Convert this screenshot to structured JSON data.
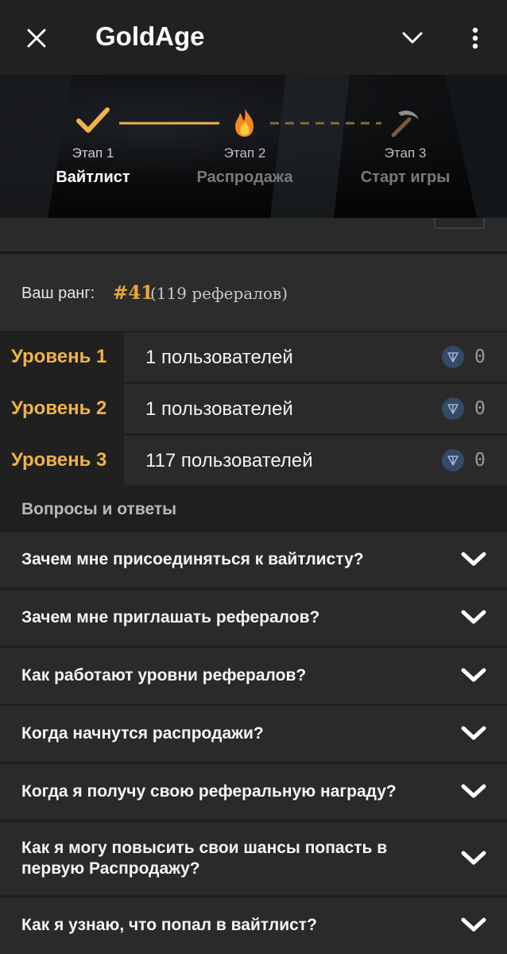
{
  "header": {
    "title": "GoldAge",
    "close_icon": "close-icon",
    "collapse_icon": "chevron-down-icon",
    "menu_icon": "more-vertical-icon"
  },
  "stages": [
    {
      "number": "Этап 1",
      "label": "Вайтлист",
      "icon": "check-icon",
      "state": "done"
    },
    {
      "number": "Этап 2",
      "label": "Распродажа",
      "icon": "fire-icon",
      "state": "current"
    },
    {
      "number": "Этап 3",
      "label": "Старт игры",
      "icon": "pickaxe-icon",
      "state": "upcoming"
    }
  ],
  "rank": {
    "label": "Ваш ранг:",
    "value": "#41",
    "referrals": "(119 рефералов)"
  },
  "levels": [
    {
      "label": "Уровень 1",
      "users": "1 пользователей",
      "reward": "0"
    },
    {
      "label": "Уровень 2",
      "users": "1 пользователей",
      "reward": "0"
    },
    {
      "label": "Уровень 3",
      "users": "117 пользователей",
      "reward": "0"
    }
  ],
  "faq": {
    "title": "Вопросы и ответы",
    "items": [
      "Зачем мне присоединяться к вайтлисту?",
      "Зачем мне приглашать рефералов?",
      "Как работают уровни рефералов?",
      "Когда начнутся распродажи?",
      "Когда я получу свою реферальную награду?",
      "Как я могу повысить свои шансы попасть в первую Распродажу?",
      "Как я узнаю, что попал в вайтлист?"
    ]
  },
  "colors": {
    "accent": "#f0b348",
    "rank_accent": "#e8a93b",
    "background": "#1f1f1f",
    "card": "#2a2a2a",
    "ton": "#344a66"
  }
}
